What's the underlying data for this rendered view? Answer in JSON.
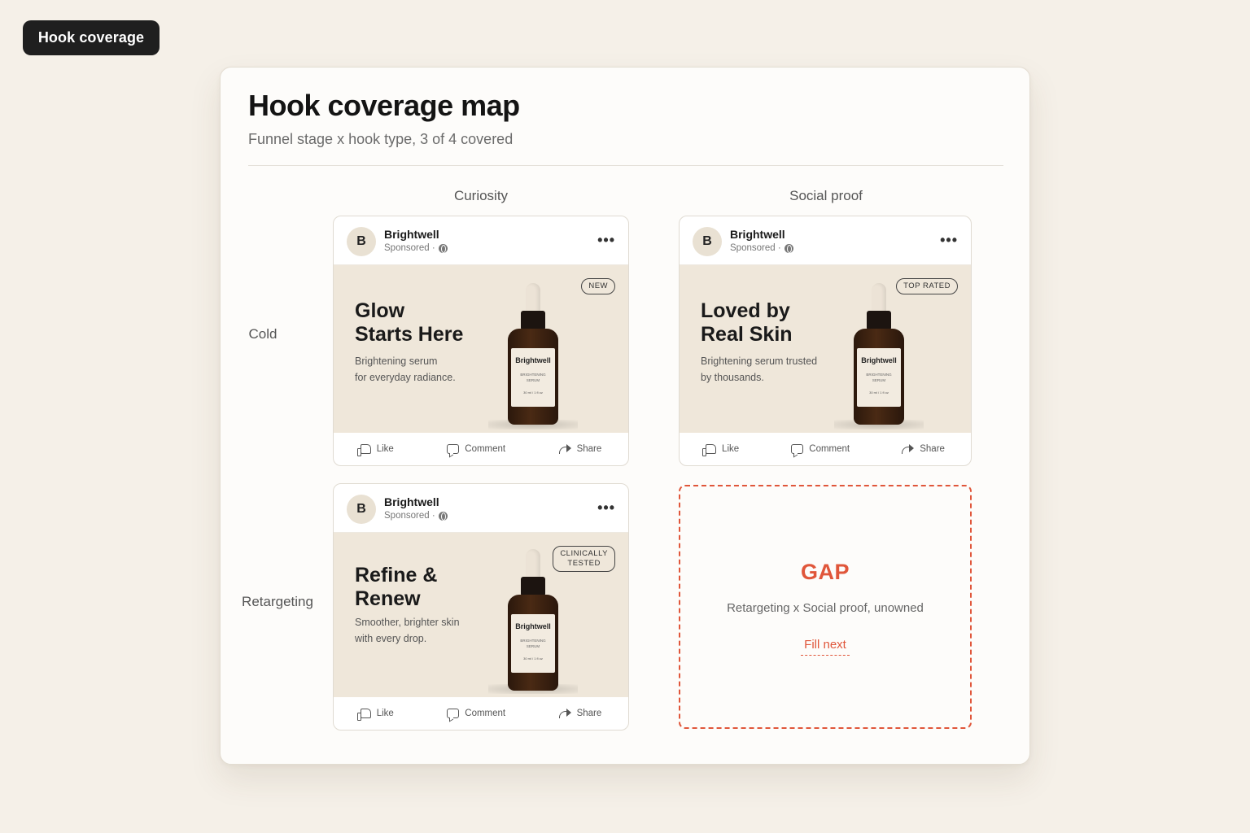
{
  "tag": {
    "label": "Hook coverage"
  },
  "panel": {
    "title": "Hook coverage map",
    "subtitle": "Funnel stage x hook type, 3 of 4 covered"
  },
  "columns": [
    "Curiosity",
    "Social proof"
  ],
  "rows": [
    "Cold",
    "Retargeting"
  ],
  "ad_common": {
    "avatar_letter": "B",
    "brand": "Brightwell",
    "sponsored": "Sponsored ·",
    "more": "•••",
    "bottle_brand": "Brightwell",
    "bottle_product_1": "BRIGHTENING",
    "bottle_product_2": "SERUM",
    "bottle_volume": "30 ml / 1 fl oz",
    "like": "Like",
    "comment": "Comment",
    "share": "Share"
  },
  "cards": [
    {
      "badge": "NEW",
      "headline_1": "Glow",
      "headline_2": "Starts Here",
      "body_1": "Brightening serum",
      "body_2": "for everyday radiance."
    },
    {
      "badge": "TOP RATED",
      "headline_1": "Loved by",
      "headline_2": "Real Skin",
      "body_1": "Brightening serum trusted",
      "body_2": "by thousands."
    },
    {
      "badge_1": "CLINICALLY",
      "badge_2": "TESTED",
      "headline_1": "Refine &",
      "headline_2": "Renew",
      "body_1": "Smoother, brighter skin",
      "body_2": "with every drop."
    }
  ],
  "gap": {
    "title": "GAP",
    "subtitle": "Retargeting x Social proof, unowned",
    "link": "Fill next",
    "color": "#e0563a"
  }
}
